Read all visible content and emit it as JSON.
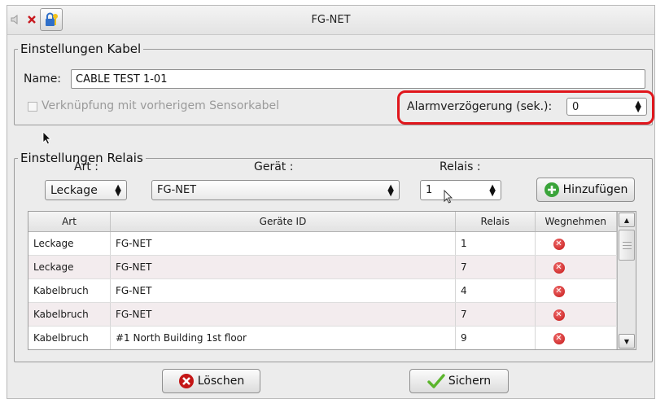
{
  "window": {
    "title": "FG-NET"
  },
  "titlebar_icons": [
    "speaker-muted-icon",
    "close-x-icon",
    "lock-key-icon"
  ],
  "kabel": {
    "legend": "Einstellungen Kabel",
    "name_label": "Name:",
    "name_value": "CABLE TEST 1-01",
    "link_label": "Verknüpfung mit vorherigem Sensorkabel",
    "link_checked": false,
    "alarm_label": "Alarmverzögerung (sek.):",
    "alarm_value": "0"
  },
  "relais": {
    "legend": "Einstellungen Relais",
    "art_label": "Art :",
    "geraet_label": "Gerät :",
    "relais_label": "Relais :",
    "art_value": "Leckage",
    "geraet_value": "FG-NET",
    "relais_value": "1",
    "add_label": "Hinzufügen",
    "table": {
      "headers": [
        "Art",
        "Geräte ID",
        "Relais",
        "Wegnehmen"
      ],
      "rows": [
        {
          "art": "Leckage",
          "geraet": "FG-NET",
          "relais": "1"
        },
        {
          "art": "Leckage",
          "geraet": "FG-NET",
          "relais": "7"
        },
        {
          "art": "Kabelbruch",
          "geraet": "FG-NET",
          "relais": "4"
        },
        {
          "art": "Kabelbruch",
          "geraet": "FG-NET",
          "relais": "7"
        },
        {
          "art": "Kabelbruch",
          "geraet": "#1 North Building 1st floor",
          "relais": "9"
        }
      ]
    }
  },
  "footer": {
    "delete_label": "Löschen",
    "save_label": "Sichern"
  },
  "colors": {
    "highlight": "#e0161c",
    "delete_red": "#c41616",
    "add_green": "#3aa43a",
    "save_green": "#5bb52c"
  }
}
